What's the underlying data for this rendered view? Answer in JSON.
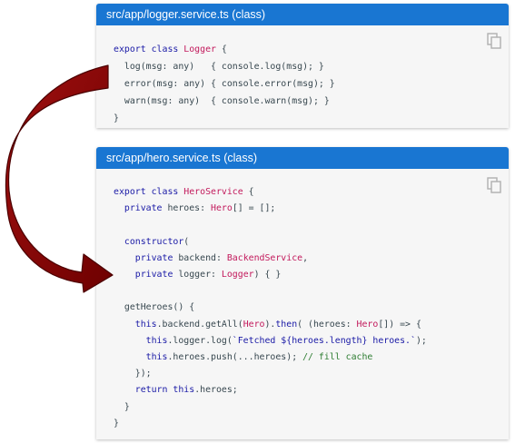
{
  "panels": [
    {
      "title": "src/app/logger.service.ts (class)",
      "copy_icon": "copy-icon"
    },
    {
      "title": "src/app/hero.service.ts (class)",
      "copy_icon": "copy-icon"
    }
  ],
  "logger_code": {
    "l1": [
      "export class",
      " ",
      "Logger",
      " {"
    ],
    "l2": "  log(msg: any)   { console.log(msg); }",
    "l3": "  error(msg: any) { console.error(msg); }",
    "l4": "  warn(msg: any)  { console.warn(msg); }",
    "l5": "}"
  },
  "hero_code": {
    "l1a": "export class",
    "l1b": "HeroService",
    "l1c": " {",
    "l2a": "  ",
    "l2b": "private",
    "l2c": " heroes: ",
    "l2d": "Hero",
    "l2e": "[] = [];",
    "l4a": "  ",
    "l4b": "constructor",
    "l4c": "(",
    "l5a": "    ",
    "l5b": "private",
    "l5c": " backend: ",
    "l5d": "BackendService",
    "l5e": ",",
    "l6a": "    ",
    "l6b": "private",
    "l6c": " logger: ",
    "l6d": "Logger",
    "l6e": ") { }",
    "l8": "  getHeroes() {",
    "l9a": "    ",
    "l9b": "this",
    "l9c": ".backend.getAll(",
    "l9d": "Hero",
    "l9e": ").",
    "l9f": "then",
    "l9g": "( (heroes: ",
    "l9h": "Hero",
    "l9i": "[]) => {",
    "l10a": "      ",
    "l10b": "this",
    "l10c": ".logger.log(",
    "l10d": "`Fetched ${heroes.length} heroes.`",
    "l10e": ");",
    "l11a": "      ",
    "l11b": "this",
    "l11c": ".heroes.push(...heroes); ",
    "l11d": "// fill cache",
    "l12": "    });",
    "l13a": "    ",
    "l13b": "return",
    "l13c": " ",
    "l13d": "this",
    "l13e": ".heroes;",
    "l14": "  }",
    "l15": "}"
  },
  "colors": {
    "header": "#1976d2",
    "keyword": "#1a1aa6",
    "type": "#c2185b",
    "comment": "#2e7d32",
    "arrow": "#8b0000"
  }
}
